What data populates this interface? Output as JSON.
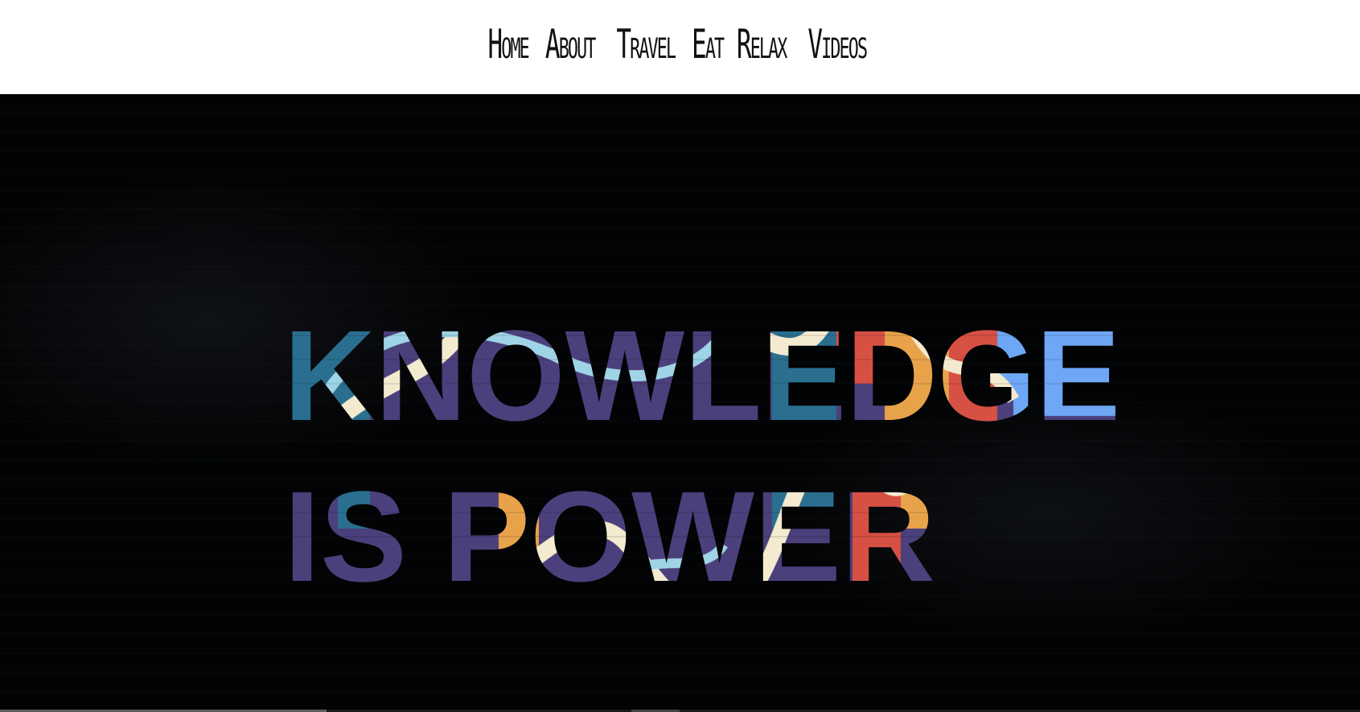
{
  "nav": {
    "items": [
      "Home",
      "About",
      "Travel",
      "Eat",
      "Relax",
      "Videos"
    ]
  },
  "hero": {
    "line1": "KNOWLEDGE",
    "line2": "IS POWER",
    "video_progress": 0.24
  },
  "colors": {
    "nav_bg": "#ffffff",
    "nav_text": "#111111",
    "hero_bg": "#020304",
    "graffiti_purple": "#4b3f7c",
    "graffiti_teal": "#2a6f8f",
    "graffiti_cream": "#f3ead0",
    "graffiti_red": "#d65044",
    "graffiti_orange": "#e8a24a",
    "graffiti_blue": "#6ea7f5"
  }
}
